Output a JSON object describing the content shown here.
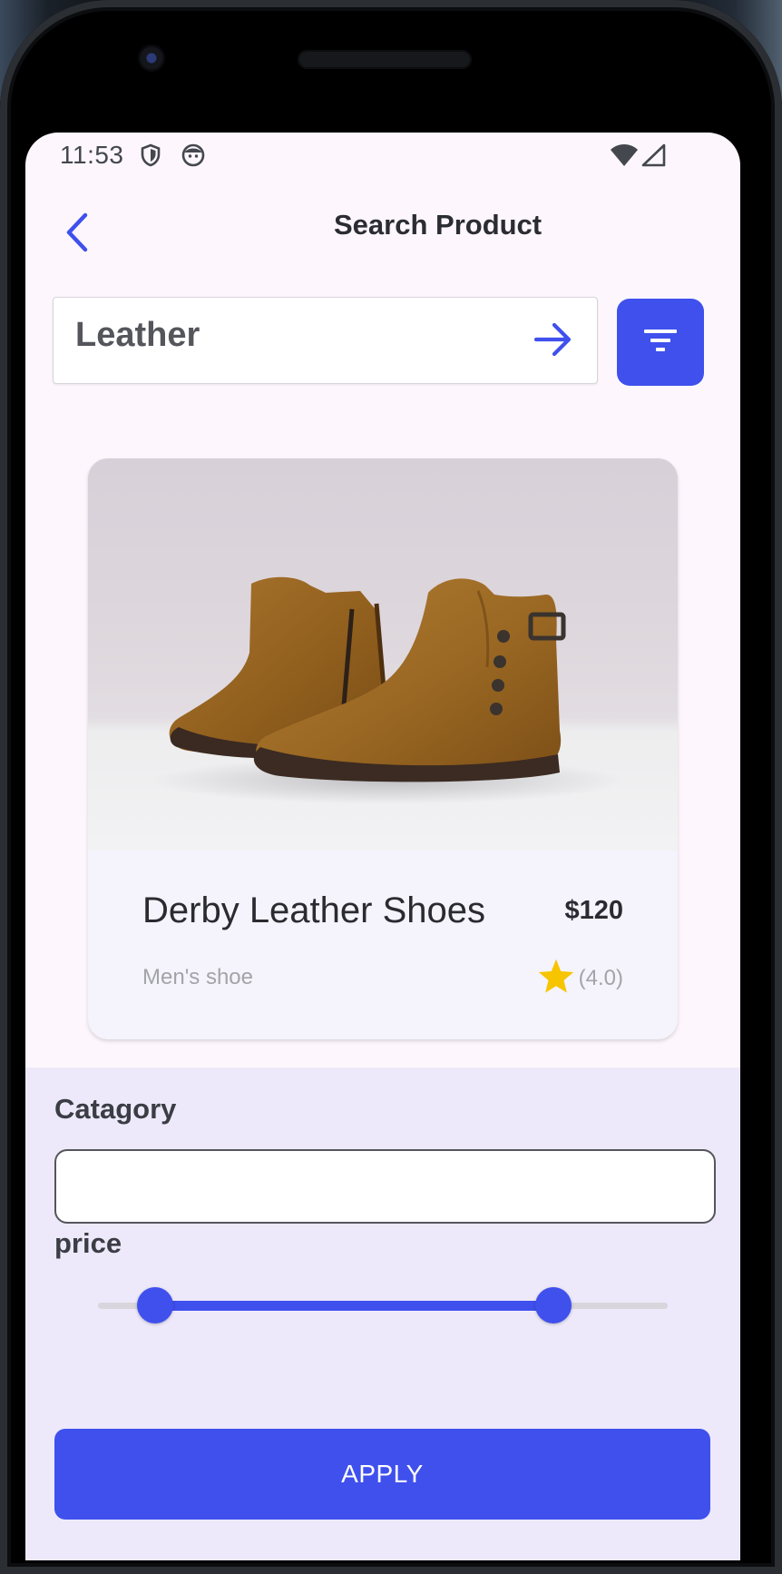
{
  "status_bar": {
    "time": "11:53"
  },
  "app_bar": {
    "title": "Search Product",
    "back_icon": "arrow-back-icon"
  },
  "search": {
    "value": "Leather",
    "go_icon": "arrow-forward-icon",
    "filter_icon": "filter-list-icon"
  },
  "product": {
    "name": "Derby Leather Shoes",
    "price": "$120",
    "category": "Men's shoe",
    "rating_text": "(4.0)",
    "rating_icon": "star-icon",
    "image_subject": "brown-leather-ankle-boots"
  },
  "filters": {
    "category_label": "Catagory",
    "category_value": "",
    "price_label": "price",
    "price_range_fraction": [
      0.1,
      0.8
    ]
  },
  "apply_label": "APPLY",
  "colors": {
    "accent": "#3f50ed",
    "screen_bg": "#fdf7fd",
    "panel_bg": "#ede9fa",
    "star": "#f7c400"
  }
}
